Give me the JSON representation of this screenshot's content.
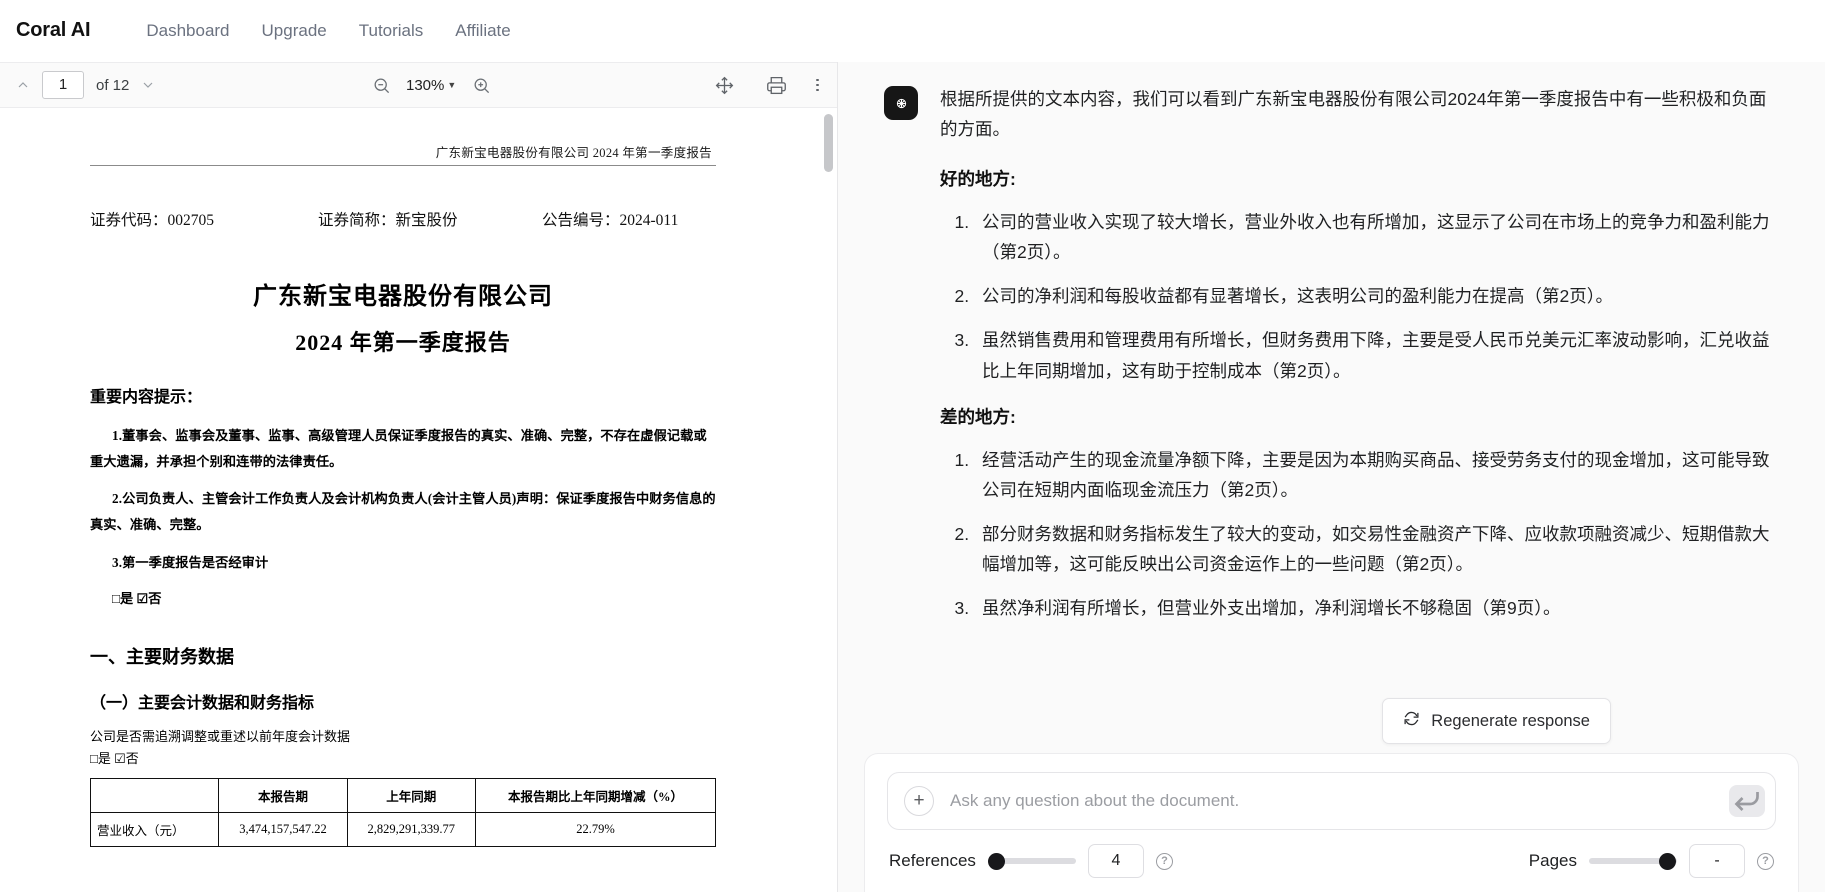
{
  "nav": {
    "brand": "Coral AI",
    "links": [
      "Dashboard",
      "Upgrade",
      "Tutorials",
      "Affiliate"
    ]
  },
  "pdf_toolbar": {
    "page_value": "1",
    "of_label": "of 12",
    "zoom_value": "130%",
    "prev_icon": "chevron-up-icon",
    "next_icon": "chevron-down-icon",
    "zoom_out_icon": "zoom-out-icon",
    "zoom_in_icon": "zoom-in-icon",
    "pan_icon": "move-pan-icon",
    "print_icon": "print-icon",
    "more_icon": "more-vertical-icon"
  },
  "document": {
    "header_line": "广东新宝电器股份有限公司 2024 年第一季度报告",
    "codes": [
      "证券代码：002705",
      "证券简称：新宝股份",
      "公告编号：2024-011"
    ],
    "title": "广东新宝电器股份有限公司",
    "subtitle": "2024 年第一季度报告",
    "notice_heading": "重要内容提示：",
    "notices": [
      "1.董事会、监事会及董事、监事、高级管理人员保证季度报告的真实、准确、完整，不存在虚假记载或重大遗漏，并承担个别和连带的法律责任。",
      "2.公司负责人、主管会计工作负责人及会计机构负责人(会计主管人员)声明：保证季度报告中财务信息的真实、准确、完整。",
      "3.第一季度报告是否经审计"
    ],
    "audited_check": "□是 ☑否",
    "section_one": "一、主要财务数据",
    "subsection_one": "（一）主要会计数据和财务指标",
    "retro_note": "公司是否需追溯调整或重述以前年度会计数据",
    "retro_check": "□是 ☑否",
    "table": {
      "headers": [
        "",
        "本报告期",
        "上年同期",
        "本报告期比上年同期增减（%）"
      ],
      "rows": [
        [
          "营业收入（元）",
          "3,474,157,547.22",
          "2,829,291,339.77",
          "22.79%"
        ]
      ]
    }
  },
  "chat": {
    "avatar_icon": "coral-brain-icon",
    "lead": "根据所提供的文本内容，我们可以看到广东新宝电器股份有限公司2024年第一季度报告中有一些积极和负面的方面。",
    "good_heading": "好的地方:",
    "good_points": [
      "公司的营业收入实现了较大增长，营业外收入也有所增加，这显示了公司在市场上的竞争力和盈利能力（第2页）。",
      "公司的净利润和每股收益都有显著增长，这表明公司的盈利能力在提高（第2页）。",
      "虽然销售费用和管理费用有所增长，但财务费用下降，主要是受人民币兑美元汇率波动影响，汇兑收益比上年同期增加，这有助于控制成本（第2页）。"
    ],
    "bad_heading": "差的地方:",
    "bad_points": [
      "经营活动产生的现金流量净额下降，主要是因为本期购买商品、接受劳务支付的现金增加，这可能导致公司在短期内面临现金流压力（第2页）。",
      "部分财务数据和财务指标发生了较大的变动，如交易性金融资产下降、应收款项融资减少、短期借款大幅增加等，这可能反映出公司资金运作上的一些问题（第2页）。",
      "虽然净利润有所增长，但营业外支出增加，净利润增长不够稳固（第9页）。"
    ],
    "regenerate_label": "Regenerate response",
    "regenerate_icon": "refresh-icon"
  },
  "composer": {
    "placeholder": "Ask any question about the document.",
    "value": "",
    "plus_icon": "plus-icon",
    "send_icon": "enter-send-icon"
  },
  "controls": {
    "references_label": "References",
    "references_value": "4",
    "references_help_icon": "help-circle-icon",
    "pages_label": "Pages",
    "pages_value": "-",
    "pages_help_icon": "help-circle-icon"
  }
}
